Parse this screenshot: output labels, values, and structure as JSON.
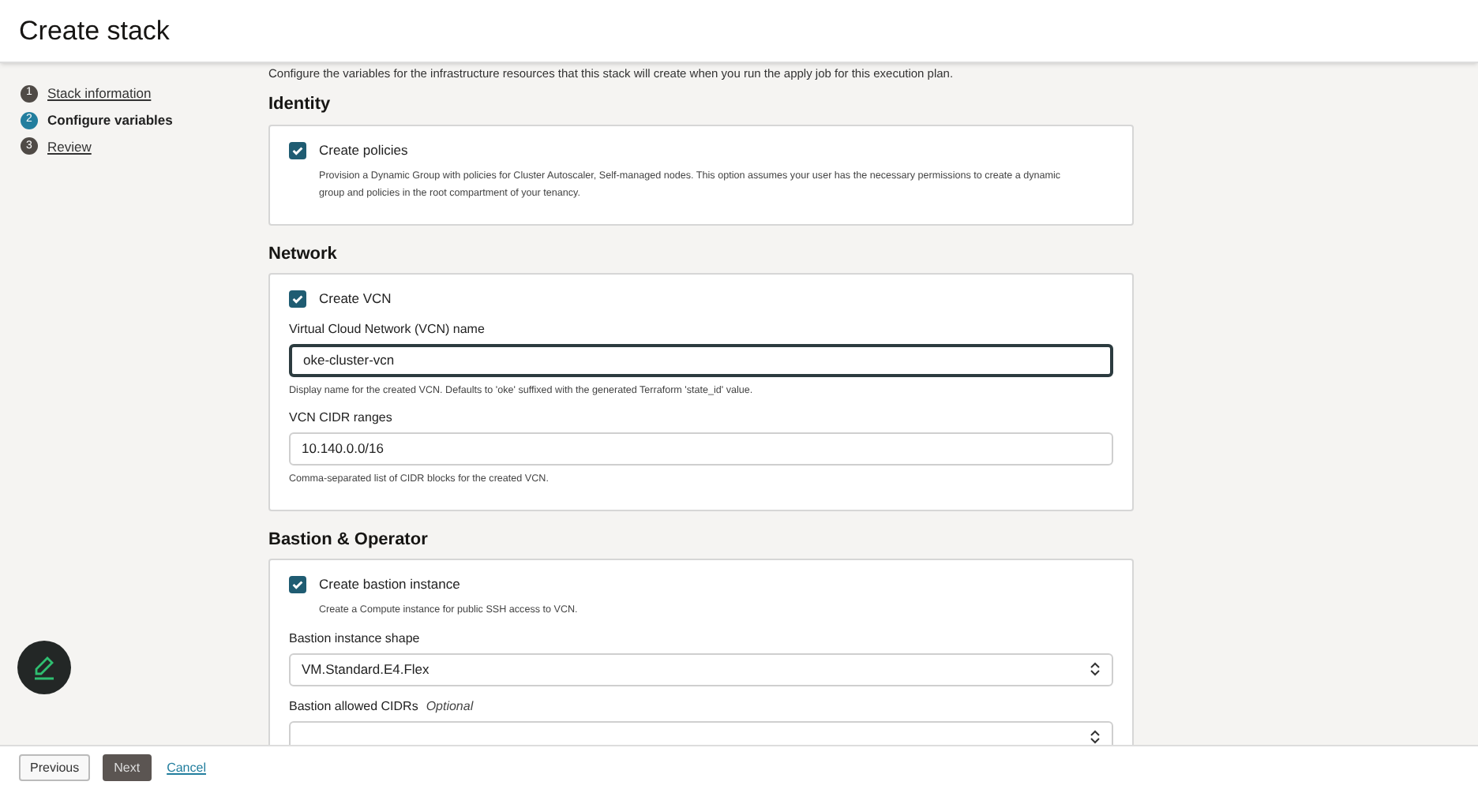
{
  "header": {
    "title": "Create stack"
  },
  "steps": [
    {
      "number": "1",
      "label": "Stack information",
      "selected": false
    },
    {
      "number": "2",
      "label": "Configure variables",
      "selected": true
    },
    {
      "number": "3",
      "label": "Review",
      "selected": false
    }
  ],
  "intro": "Configure the variables for the infrastructure resources that this stack will create when you run the apply job for this execution plan.",
  "sections": [
    {
      "title": "Identity",
      "items": [
        {
          "kind": "checkbox",
          "label": "Create policies",
          "checked": true,
          "help": "Provision a Dynamic Group with policies for Cluster Autoscaler, Self-managed nodes. This option assumes your user has the necessary permissions to create a dynamic group and policies in the root compartment of your tenancy."
        }
      ]
    },
    {
      "title": "Network",
      "items": [
        {
          "kind": "checkbox",
          "label": "Create VCN",
          "checked": true
        },
        {
          "kind": "text",
          "label": "Virtual Cloud Network (VCN) name",
          "value": "oke-cluster-vcn",
          "focused": true,
          "help": "Display name for the created VCN. Defaults to 'oke' suffixed with the generated Terraform 'state_id' value."
        },
        {
          "kind": "text",
          "label": "VCN CIDR ranges",
          "value": "10.140.0.0/16",
          "focused": false,
          "help": "Comma-separated list of CIDR blocks for the created VCN."
        }
      ]
    },
    {
      "title": "Bastion & Operator",
      "items": [
        {
          "kind": "checkbox",
          "label": "Create bastion instance",
          "checked": true,
          "help": "Create a Compute instance for public SSH access to VCN."
        },
        {
          "kind": "select",
          "label": "Bastion instance shape",
          "value": "VM.Standard.E4.Flex"
        },
        {
          "kind": "select",
          "label": "Bastion allowed CIDRs",
          "optional": "Optional"
        }
      ]
    }
  ],
  "footer": {
    "previous": "Previous",
    "next": "Next",
    "cancel": "Cancel"
  }
}
